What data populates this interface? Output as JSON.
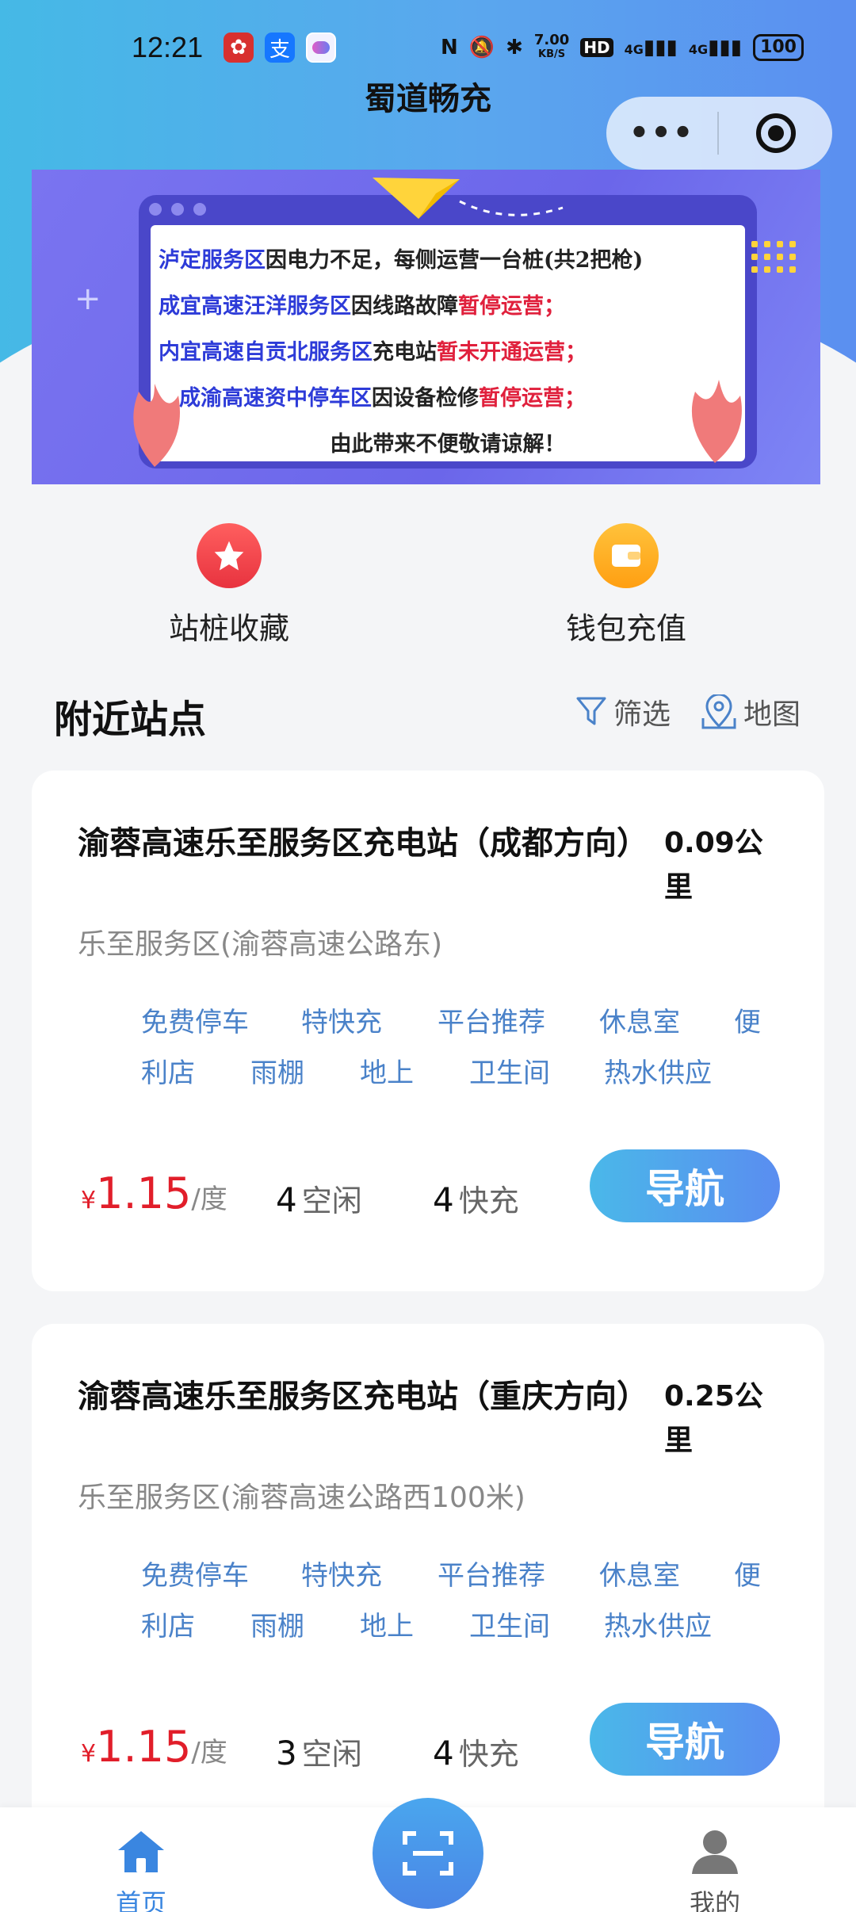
{
  "status_bar": {
    "time": "12:21",
    "network_speed": "7.00",
    "speed_unit": "KB/S",
    "hd": "HD",
    "signal1": "4G",
    "signal2": "4G",
    "battery": "100"
  },
  "header": {
    "title": "蜀道畅充",
    "capsule_more_icon": "more-dots-icon",
    "capsule_close_icon": "target-icon"
  },
  "banner": {
    "lines": [
      {
        "blue": "泸定服务区",
        "black": "因电力不足，每侧运营一台桩(共2把枪)",
        "red": ""
      },
      {
        "blue": "成宜高速汪洋服务区",
        "black": "因线路故障",
        "red": "暂停运营；"
      },
      {
        "blue": "内宜高速自贡北服务区",
        "black": "充电站",
        "red": "暂未开通运营；"
      },
      {
        "blue": "成渝高速资中停车区",
        "black": "因设备检修",
        "red": "暂停运营；"
      },
      {
        "blue": "",
        "black": "由此带来不便敬请谅解！",
        "red": ""
      }
    ]
  },
  "quick_actions": {
    "favorites": {
      "label": "站桩收藏",
      "icon": "star-icon",
      "color": "#f0434b"
    },
    "wallet": {
      "label": "钱包充值",
      "icon": "wallet-icon",
      "color": "#ffaa1e"
    }
  },
  "nearby": {
    "title": "附近站点",
    "filter_label": "筛选",
    "map_label": "地图"
  },
  "stations": [
    {
      "name": "渝蓉高速乐至服务区充电站（成都方向）",
      "distance": "0.09公里",
      "address": "乐至服务区(渝蓉高速公路东)",
      "tags": [
        "免费停车",
        "特快充",
        "平台推荐",
        "休息室",
        "便",
        "利店",
        "雨棚",
        "地上",
        "卫生间",
        "热水供应"
      ],
      "currency": "¥",
      "price": "1.15",
      "price_unit": "/度",
      "idle_count": "4",
      "idle_label": "空闲",
      "fast_count": "4",
      "fast_label": "快充",
      "nav_label": "导航"
    },
    {
      "name": "渝蓉高速乐至服务区充电站（重庆方向）",
      "distance": "0.25公里",
      "address": "乐至服务区(渝蓉高速公路西100米)",
      "tags": [
        "免费停车",
        "特快充",
        "平台推荐",
        "休息室",
        "便",
        "利店",
        "雨棚",
        "地上",
        "卫生间",
        "热水供应"
      ],
      "currency": "¥",
      "price": "1.15",
      "price_unit": "/度",
      "idle_count": "3",
      "idle_label": "空闲",
      "fast_count": "4",
      "fast_label": "快充",
      "nav_label": "导航"
    }
  ],
  "tab_bar": {
    "home": "首页",
    "mine": "我的",
    "accent": "#3a86e0"
  }
}
